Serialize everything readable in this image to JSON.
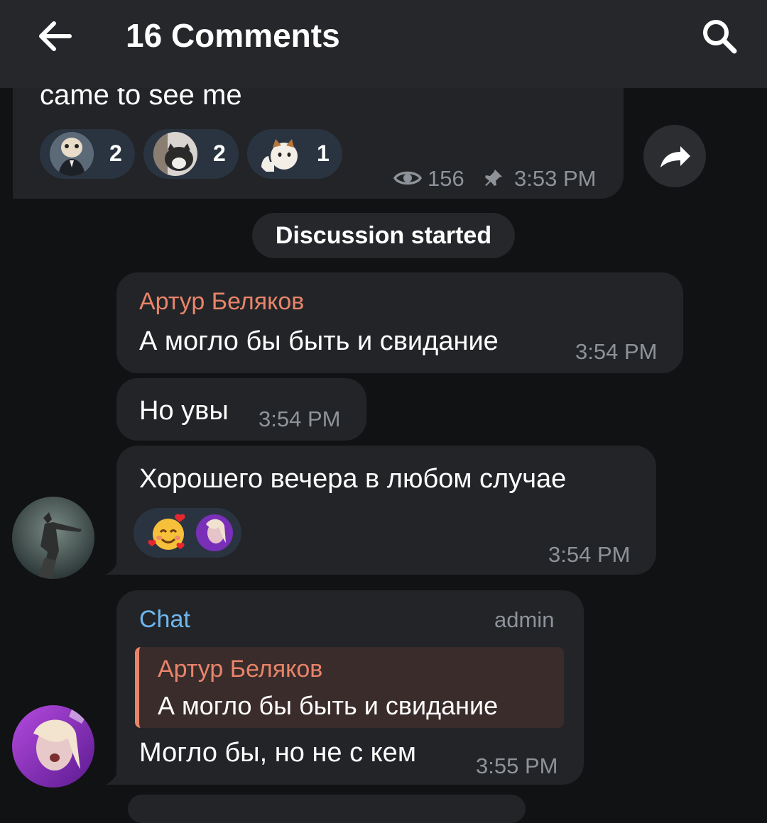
{
  "header": {
    "title": "16 Comments"
  },
  "post": {
    "text": "came to see me",
    "reactions": [
      {
        "icon": "dog-suit-sticker-icon",
        "count": "2"
      },
      {
        "icon": "cat-sticker-icon",
        "count": "2"
      },
      {
        "icon": "thumbs-up-cat-sticker-icon",
        "count": "1"
      }
    ],
    "views": "156",
    "time": "3:53 PM"
  },
  "service_message": "Discussion started",
  "messages": [
    {
      "author": "Артур Беляков",
      "text": "А могло бы быть и свидание",
      "time": "3:54 PM"
    },
    {
      "text": "Но увы",
      "time": "3:54 PM"
    },
    {
      "text": "Хорошего вечера в любом случае",
      "time": "3:54 PM",
      "reactions": [
        {
          "icon": "smiling-face-with-hearts-icon"
        },
        {
          "icon": "user-avatar-reaction-icon"
        }
      ]
    },
    {
      "author": "Chat",
      "role": "admin",
      "reply": {
        "author": "Артур Беляков",
        "text": "А могло бы быть и свидание"
      },
      "text": "Могло бы, но не с кем",
      "time": "3:55 PM"
    }
  ],
  "colors": {
    "background": "#111213",
    "bubble": "#222427",
    "header": "#25272a",
    "author_red": "#e8846a",
    "author_blue": "#6fb6ee",
    "meta": "#8e939a"
  }
}
